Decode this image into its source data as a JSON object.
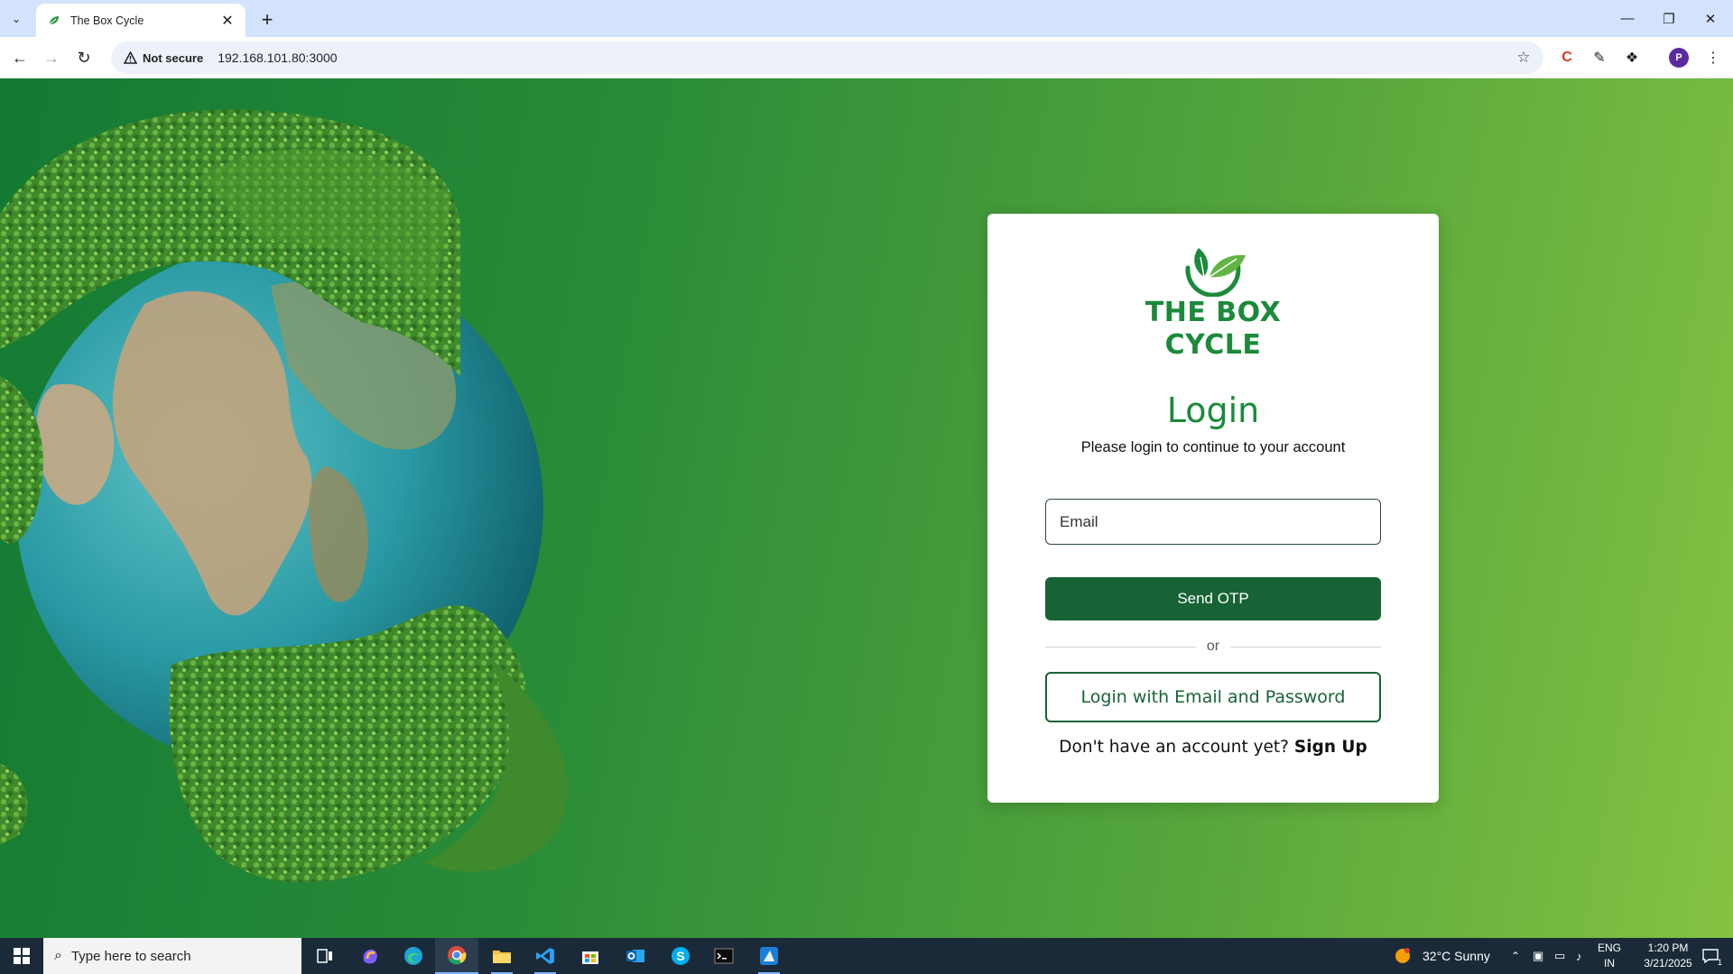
{
  "browser": {
    "tab_title": "The Box Cycle",
    "security_label": "Not secure",
    "url": "192.168.101.80:3000"
  },
  "profile": {
    "initial": "P"
  },
  "brand": {
    "line1": "THE BOX",
    "line2": "CYCLE",
    "color": "#1b8a3a"
  },
  "login": {
    "title": "Login",
    "subtitle": "Please login to continue to your account",
    "email_placeholder": "Email",
    "send_otp_label": "Send OTP",
    "divider_text": "or",
    "alt_login_label": "Login with Email and Password",
    "signup_prompt": "Don't have an account yet?",
    "signup_link": "Sign Up"
  },
  "taskbar": {
    "search_placeholder": "Type here to search",
    "weather": "32°C  Sunny",
    "language": "ENG",
    "region": "IN",
    "time": "1:20 PM",
    "date": "3/21/2025",
    "notification_count": "1"
  },
  "colors": {
    "primary": "#176335",
    "accent": "#1b8a3a"
  }
}
